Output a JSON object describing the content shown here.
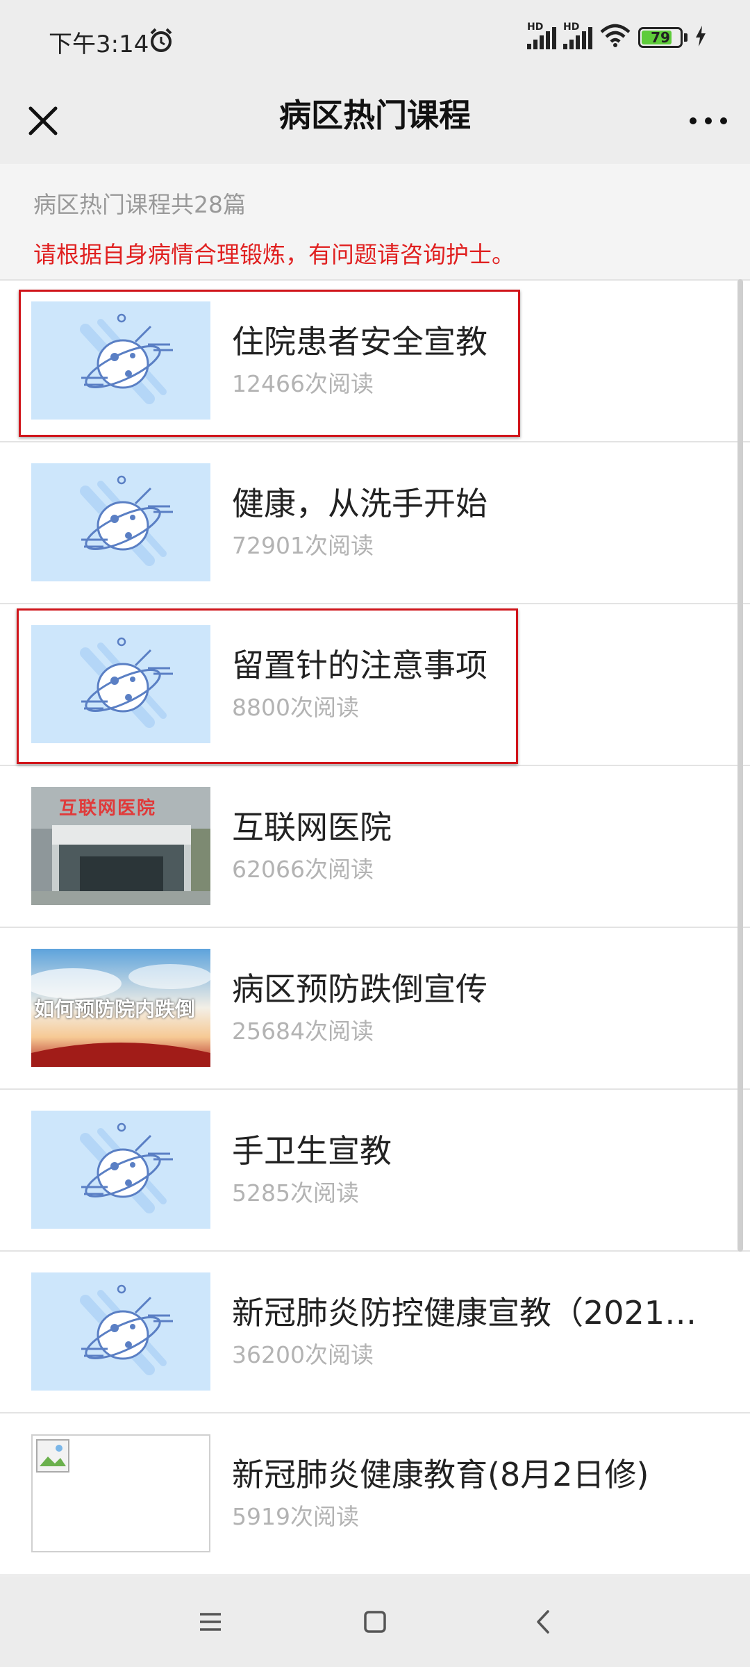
{
  "status": {
    "time": "下午3:14",
    "hd1": "HD",
    "hd2": "HD",
    "battery_level": "79",
    "battery_fraction": 0.79,
    "icons": [
      "alarm-icon",
      "signal-icon",
      "wifi-icon",
      "battery-icon",
      "charging-icon"
    ]
  },
  "nav": {
    "title": "病区热门课程",
    "close_icon": "close-icon",
    "more_icon": "more-icon"
  },
  "intro": {
    "count_text": "病区热门课程共28篇",
    "notice_text": "请根据自身病情合理锻炼，有问题请咨询护士。",
    "notice_color": "#e02020"
  },
  "courses": [
    {
      "title": "住院患者安全宣教",
      "reads": "12466次阅读",
      "thumb": "planet-placeholder",
      "highlighted": true
    },
    {
      "title": "健康，从洗手开始",
      "reads": "72901次阅读",
      "thumb": "planet-placeholder",
      "highlighted": false
    },
    {
      "title": "留置针的注意事项",
      "reads": "8800次阅读",
      "thumb": "planet-placeholder",
      "highlighted": true
    },
    {
      "title": "互联网医院",
      "reads": "62066次阅读",
      "thumb": "hospital-photo",
      "thumb_text": "互联网医院",
      "highlighted": false
    },
    {
      "title": "病区预防跌倒宣传",
      "reads": "25684次阅读",
      "thumb": "sky-banner",
      "thumb_text": "如何预防院内跌倒",
      "highlighted": false
    },
    {
      "title": "手卫生宣教",
      "reads": "5285次阅读",
      "thumb": "planet-placeholder",
      "highlighted": false
    },
    {
      "title": "新冠肺炎防控健康宣教（2021…",
      "reads": "36200次阅读",
      "thumb": "planet-placeholder",
      "highlighted": false
    },
    {
      "title": "新冠肺炎健康教育(8月2日修)",
      "reads": "5919次阅读",
      "thumb": "broken-image",
      "highlighted": false
    }
  ],
  "bottom_nav": {
    "icons": [
      "menu-icon",
      "home-icon",
      "back-icon"
    ]
  },
  "colors": {
    "background": "#ededed",
    "highlight_border": "#d0151b",
    "placeholder_bg": "#cde6fb"
  }
}
